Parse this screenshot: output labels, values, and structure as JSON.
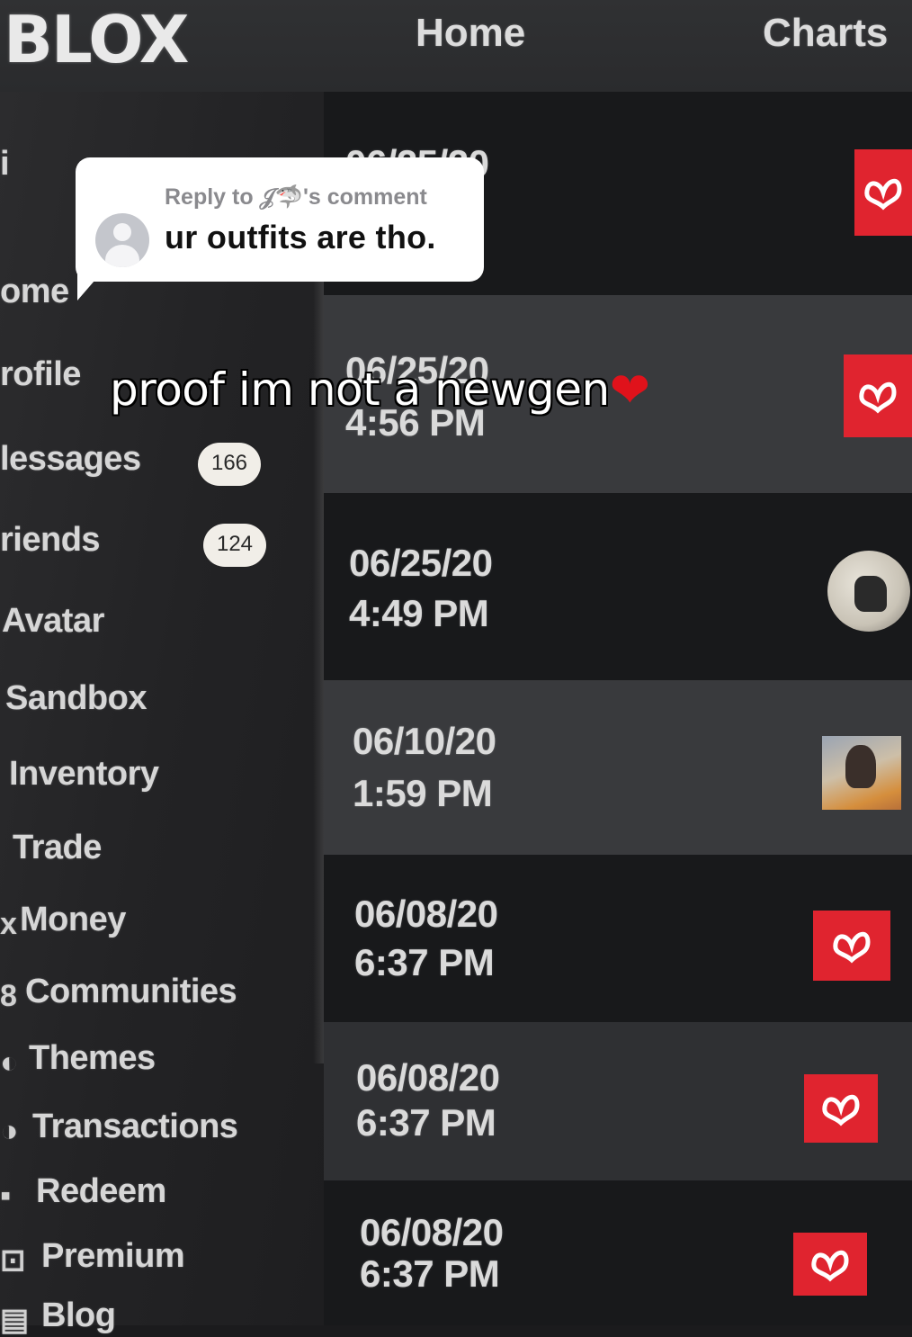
{
  "header": {
    "logo": "BLOX",
    "nav_home": "Home",
    "nav_charts": "Charts"
  },
  "sidebar": {
    "items": [
      {
        "label": "i"
      },
      {
        "label": "ome"
      },
      {
        "label": "rofile"
      },
      {
        "label": "lessages",
        "badge": "166"
      },
      {
        "label": "riends",
        "badge": "124"
      },
      {
        "label": "Avatar"
      },
      {
        "label": "Sandbox"
      },
      {
        "label": "Inventory"
      },
      {
        "label": "Trade"
      },
      {
        "label": "Money"
      },
      {
        "label": "Communities"
      },
      {
        "label": "Themes"
      },
      {
        "label": "Transactions"
      },
      {
        "label": "Redeem"
      },
      {
        "label": "Premium"
      },
      {
        "label": "Blog"
      }
    ]
  },
  "feed": {
    "rows": [
      {
        "date": "06/25/20",
        "time": "",
        "thumb": "red-butterfly"
      },
      {
        "date": "06/25/20",
        "time": "4:56 PM",
        "thumb": "red-butterfly"
      },
      {
        "date": "06/25/20",
        "time": "4:49 PM",
        "thumb": "round-avatar"
      },
      {
        "date": "06/10/20",
        "time": "1:59 PM",
        "thumb": "photo"
      },
      {
        "date": "06/08/20",
        "time": "6:37 PM",
        "thumb": "red-butterfly"
      },
      {
        "date": "06/08/20",
        "time": "6:37 PM",
        "thumb": "red-butterfly"
      },
      {
        "date": "06/08/20",
        "time": "6:37 PM",
        "thumb": "red-butterfly"
      }
    ]
  },
  "reply": {
    "label": "Reply to 𝒥🦈's comment",
    "text": "ur outfits are tho."
  },
  "caption": {
    "text": "proof im not a newgen",
    "emoji": "❤"
  },
  "colors": {
    "accent_red": "#e0242f",
    "row_dark": "#18191b",
    "row_light": "#393a3d"
  }
}
